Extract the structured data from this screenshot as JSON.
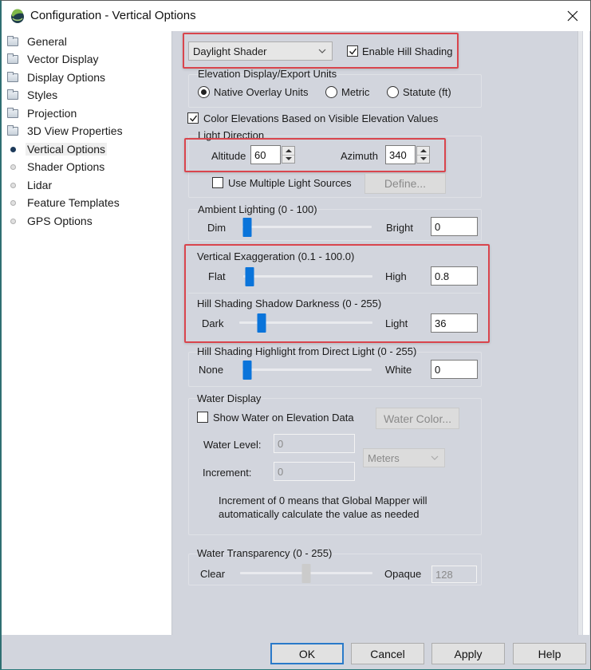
{
  "window": {
    "title": "Configuration - Vertical Options",
    "icons": {
      "app": "globe-swirl-icon",
      "close": "close-icon"
    }
  },
  "sidebar": {
    "items": [
      {
        "label": "General",
        "icon": "folder-icon",
        "selected": false
      },
      {
        "label": "Vector Display",
        "icon": "folder-icon",
        "selected": false
      },
      {
        "label": "Display Options",
        "icon": "folder-icon",
        "selected": false
      },
      {
        "label": "Styles",
        "icon": "folder-icon",
        "selected": false
      },
      {
        "label": "Projection",
        "icon": "folder-icon",
        "selected": false
      },
      {
        "label": "3D View Properties",
        "icon": "folder-icon",
        "selected": false
      },
      {
        "label": "Vertical Options",
        "icon": "bullet-dark-icon",
        "selected": true
      },
      {
        "label": "Shader Options",
        "icon": "bullet-light-icon",
        "selected": false
      },
      {
        "label": "Lidar",
        "icon": "bullet-light-icon",
        "selected": false
      },
      {
        "label": "Feature Templates",
        "icon": "bullet-light-icon",
        "selected": false
      },
      {
        "label": "GPS Options",
        "icon": "bullet-light-icon",
        "selected": false
      }
    ]
  },
  "shader": {
    "selected": "Daylight Shader",
    "enable_hill_shading_label": "Enable Hill Shading",
    "enable_hill_shading_checked": true
  },
  "elevation_units": {
    "group_label": "Elevation Display/Export Units",
    "options": [
      "Native Overlay Units",
      "Metric",
      "Statute (ft)"
    ],
    "selected": "Native Overlay Units"
  },
  "color_elevations": {
    "label": "Color Elevations Based on Visible Elevation Values",
    "checked": true
  },
  "light_direction": {
    "group_label": "Light Direction",
    "altitude_label": "Altitude",
    "altitude_value": "60",
    "azimuth_label": "Azimuth",
    "azimuth_value": "340",
    "multiple_sources_label": "Use Multiple Light Sources",
    "multiple_sources_checked": false,
    "define_button": "Define..."
  },
  "ambient_lighting": {
    "group_label": "Ambient Lighting (0 - 100)",
    "min_label": "Dim",
    "max_label": "Bright",
    "value": "0",
    "range": [
      0,
      100
    ],
    "slider_value": 0
  },
  "vertical_exaggeration": {
    "group_label": "Vertical Exaggeration (0.1 - 100.0)",
    "min_label": "Flat",
    "max_label": "High",
    "value": "0.8",
    "slider_fraction": 0.01
  },
  "shadow_darkness": {
    "group_label": "Hill Shading Shadow Darkness (0 - 255)",
    "min_label": "Dark",
    "max_label": "Light",
    "value": "36",
    "range": [
      0,
      255
    ],
    "slider_value": 36
  },
  "highlight": {
    "group_label": "Hill Shading Highlight from Direct Light (0 - 255)",
    "min_label": "None",
    "max_label": "White",
    "value": "0",
    "range": [
      0,
      255
    ],
    "slider_value": 0
  },
  "water_display": {
    "group_label": "Water Display",
    "show_water_label": "Show Water on Elevation Data",
    "show_water_checked": false,
    "water_color_button": "Water Color...",
    "water_level_label": "Water Level:",
    "water_level_value": "0",
    "increment_label": "Increment:",
    "increment_value": "0",
    "units_selected": "Meters",
    "note": "Increment of 0 means that Global Mapper will\nautomatically calculate the value as needed"
  },
  "water_transparency": {
    "group_label": "Water Transparency (0 - 255)",
    "min_label": "Clear",
    "max_label": "Opaque",
    "value": "128",
    "range": [
      0,
      255
    ],
    "slider_value": 128
  },
  "footer": {
    "ok": "OK",
    "cancel": "Cancel",
    "apply": "Apply",
    "help": "Help"
  },
  "colors": {
    "panel_bg": "#d2d5dd",
    "highlight_box": "#d9454d",
    "slider_thumb": "#0a74da",
    "default_button_border": "#2a7ac9"
  }
}
